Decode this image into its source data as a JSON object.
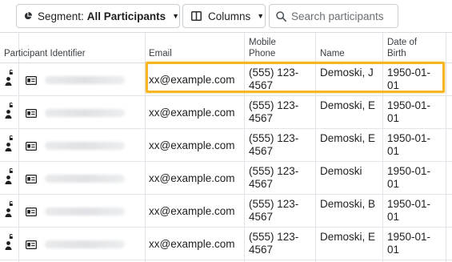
{
  "toolbar": {
    "segment_prefix": "Segment:",
    "segment_value": "All Participants",
    "columns_label": "Columns",
    "search_placeholder": "Search participants"
  },
  "table": {
    "headers": [
      "Participant Identifier",
      "Email",
      "Mobile Phone",
      "Name",
      "Date of Birth"
    ],
    "rows": [
      {
        "email": "xx@example.com",
        "phone": "(555) 123-4567",
        "name": "Demoski, J",
        "dob": "1950-01-01"
      },
      {
        "email": "xx@example.com",
        "phone": "(555) 123-4567",
        "name": "Demoski, E",
        "dob": "1950-01-01"
      },
      {
        "email": "xx@example.com",
        "phone": "(555) 123-4567",
        "name": "Demoski, E",
        "dob": "1950-01-01"
      },
      {
        "email": "xx@example.com",
        "phone": "(555) 123-4567",
        "name": "Demoski",
        "dob": "1950-01-01"
      },
      {
        "email": "xx@example.com",
        "phone": "(555) 123-4567",
        "name": "Demoski, B",
        "dob": "1950-01-01"
      },
      {
        "email": "xx@example.com",
        "phone": "(555) 123-4567",
        "name": "Demoski, E",
        "dob": "1950-01-01"
      }
    ],
    "selected_row": 0
  },
  "colors": {
    "highlight": "#f5b621",
    "border": "#c9ced4",
    "grid_line": "#e1e4e8"
  },
  "icons": {
    "segment": "pie-chart-icon",
    "columns": "columns-icon",
    "search": "search-icon",
    "row_person": "person-lock-icon",
    "row_card": "id-card-icon"
  }
}
